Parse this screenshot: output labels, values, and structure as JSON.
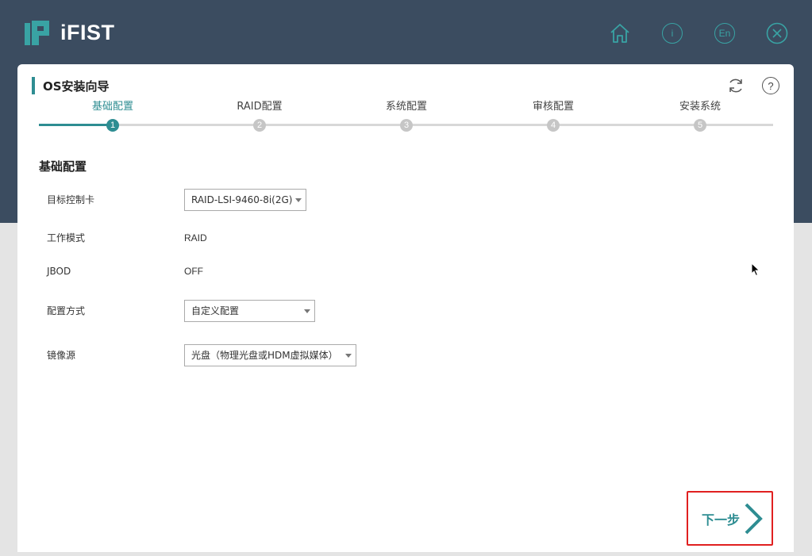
{
  "app": {
    "name": "iFIST",
    "brand_color": "#2e8d92",
    "header_bg": "#3b4c60"
  },
  "header_icons": [
    {
      "name": "home-icon"
    },
    {
      "name": "info-icon",
      "text": "i"
    },
    {
      "name": "language-icon",
      "text": "En"
    },
    {
      "name": "close-icon"
    }
  ],
  "panel": {
    "title": "OS安装向导",
    "refresh_icon": "refresh-icon",
    "help_icon_text": "?"
  },
  "steps": [
    {
      "label": "基础配置",
      "num": "1",
      "active": true
    },
    {
      "label": "RAID配置",
      "num": "2",
      "active": false
    },
    {
      "label": "系统配置",
      "num": "3",
      "active": false
    },
    {
      "label": "审核配置",
      "num": "4",
      "active": false
    },
    {
      "label": "安装系统",
      "num": "5",
      "active": false
    }
  ],
  "form": {
    "section_title": "基础配置",
    "target_controller": {
      "label": "目标控制卡",
      "value": "RAID-LSI-9460-8i(2G)"
    },
    "work_mode": {
      "label": "工作模式",
      "value": "RAID"
    },
    "jbod": {
      "label": "JBOD",
      "value": "OFF"
    },
    "config_method": {
      "label": "配置方式",
      "value": "自定义配置"
    },
    "image_source": {
      "label": "镜像源",
      "value": "光盘（物理光盘或HDM虚拟媒体）"
    }
  },
  "next_button": {
    "label": "下一步"
  }
}
